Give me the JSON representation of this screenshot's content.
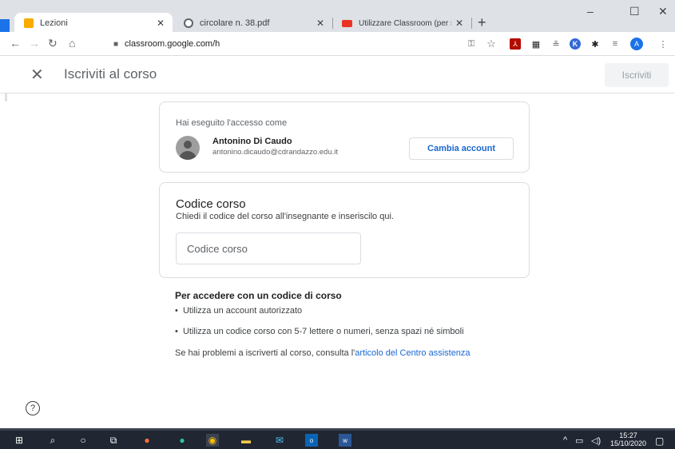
{
  "browser": {
    "tabs": [
      {
        "label": "Lezioni",
        "favicon_color": "#f9ab00"
      },
      {
        "label": "circolare n. 38.pdf",
        "favicon_color": "#5f6368"
      },
      {
        "label": "Utilizzare Classroom (per student",
        "favicon_color": "#ea3323"
      }
    ],
    "url": "classroom.google.com/h",
    "window_controls": [
      "–",
      "☐",
      "✕"
    ],
    "profile_initial": "A"
  },
  "header": {
    "close_icon": "✕",
    "title": "Iscriviti al corso",
    "join_button": "Iscriviti"
  },
  "account_card": {
    "label": "Hai eseguito l'accesso come",
    "name": "Antonino Di Caudo",
    "email": "antonino.dicaudo@cdrandazzo.edu.it",
    "switch_button": "Cambia account"
  },
  "code_card": {
    "heading": "Codice corso",
    "subtitle": "Chiedi il codice del corso all'insegnante e inseriscilo qui.",
    "input_placeholder": "Codice corso"
  },
  "info": {
    "heading": "Per accedere con un codice di corso",
    "bullets": [
      "Utilizza un account autorizzato",
      "Utilizza un codice corso con 5-7 lettere o numeri, senza spazi né simboli"
    ],
    "help_prefix": "Se hai problemi a iscriverti al corso, consulta l'",
    "help_link": "articolo del Centro assistenza"
  },
  "help_icon": "?",
  "taskbar": {
    "time": "15:27",
    "date": "15/10/2020"
  },
  "colors": {
    "link": "#1967d2",
    "taskbar": "#202632",
    "tab_bar": "#dee1e6"
  }
}
